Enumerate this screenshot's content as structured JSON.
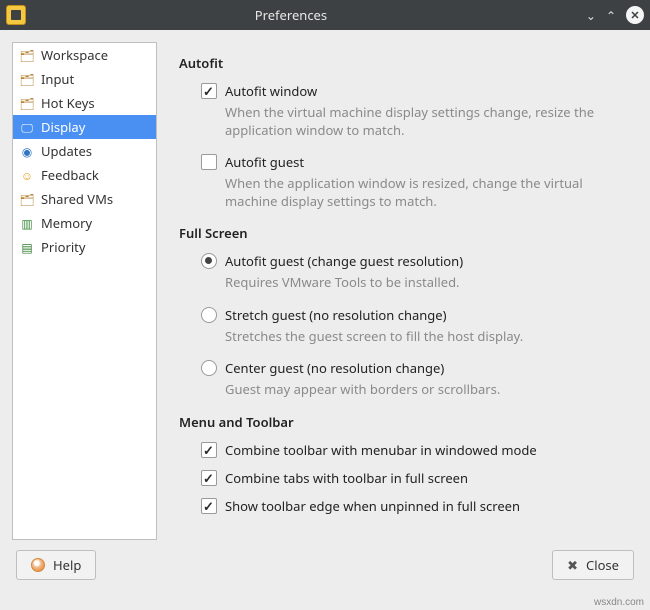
{
  "window": {
    "title": "Preferences"
  },
  "sidebar": {
    "items": [
      {
        "label": "Workspace",
        "selected": false
      },
      {
        "label": "Input",
        "selected": false
      },
      {
        "label": "Hot Keys",
        "selected": false
      },
      {
        "label": "Display",
        "selected": true
      },
      {
        "label": "Updates",
        "selected": false
      },
      {
        "label": "Feedback",
        "selected": false
      },
      {
        "label": "Shared VMs",
        "selected": false
      },
      {
        "label": "Memory",
        "selected": false
      },
      {
        "label": "Priority",
        "selected": false
      }
    ]
  },
  "display": {
    "autofit": {
      "title": "Autofit",
      "autofit_window": {
        "label": "Autofit window",
        "desc": "When the virtual machine display settings change, resize the application window to match.",
        "checked": true
      },
      "autofit_guest": {
        "label": "Autofit guest",
        "desc": "When the application window is resized, change the virtual machine display settings to match.",
        "checked": false
      }
    },
    "fullscreen": {
      "title": "Full Screen",
      "autofit_guest": {
        "label": "Autofit guest (change guest resolution)",
        "desc": "Requires VMware Tools to be installed.",
        "checked": true
      },
      "stretch_guest": {
        "label": "Stretch guest (no resolution change)",
        "desc": "Stretches the guest screen to fill the host display.",
        "checked": false
      },
      "center_guest": {
        "label": "Center guest (no resolution change)",
        "desc": "Guest may appear with borders or scrollbars.",
        "checked": false
      }
    },
    "menu_toolbar": {
      "title": "Menu and Toolbar",
      "combine_toolbar": {
        "label": "Combine toolbar with menubar in windowed mode",
        "checked": true
      },
      "combine_tabs": {
        "label": "Combine tabs with toolbar in full screen",
        "checked": true
      },
      "show_edge": {
        "label": "Show toolbar edge when unpinned in full screen",
        "checked": true
      }
    }
  },
  "footer": {
    "help": "Help",
    "close": "Close"
  },
  "watermark": "wsxdn.com"
}
